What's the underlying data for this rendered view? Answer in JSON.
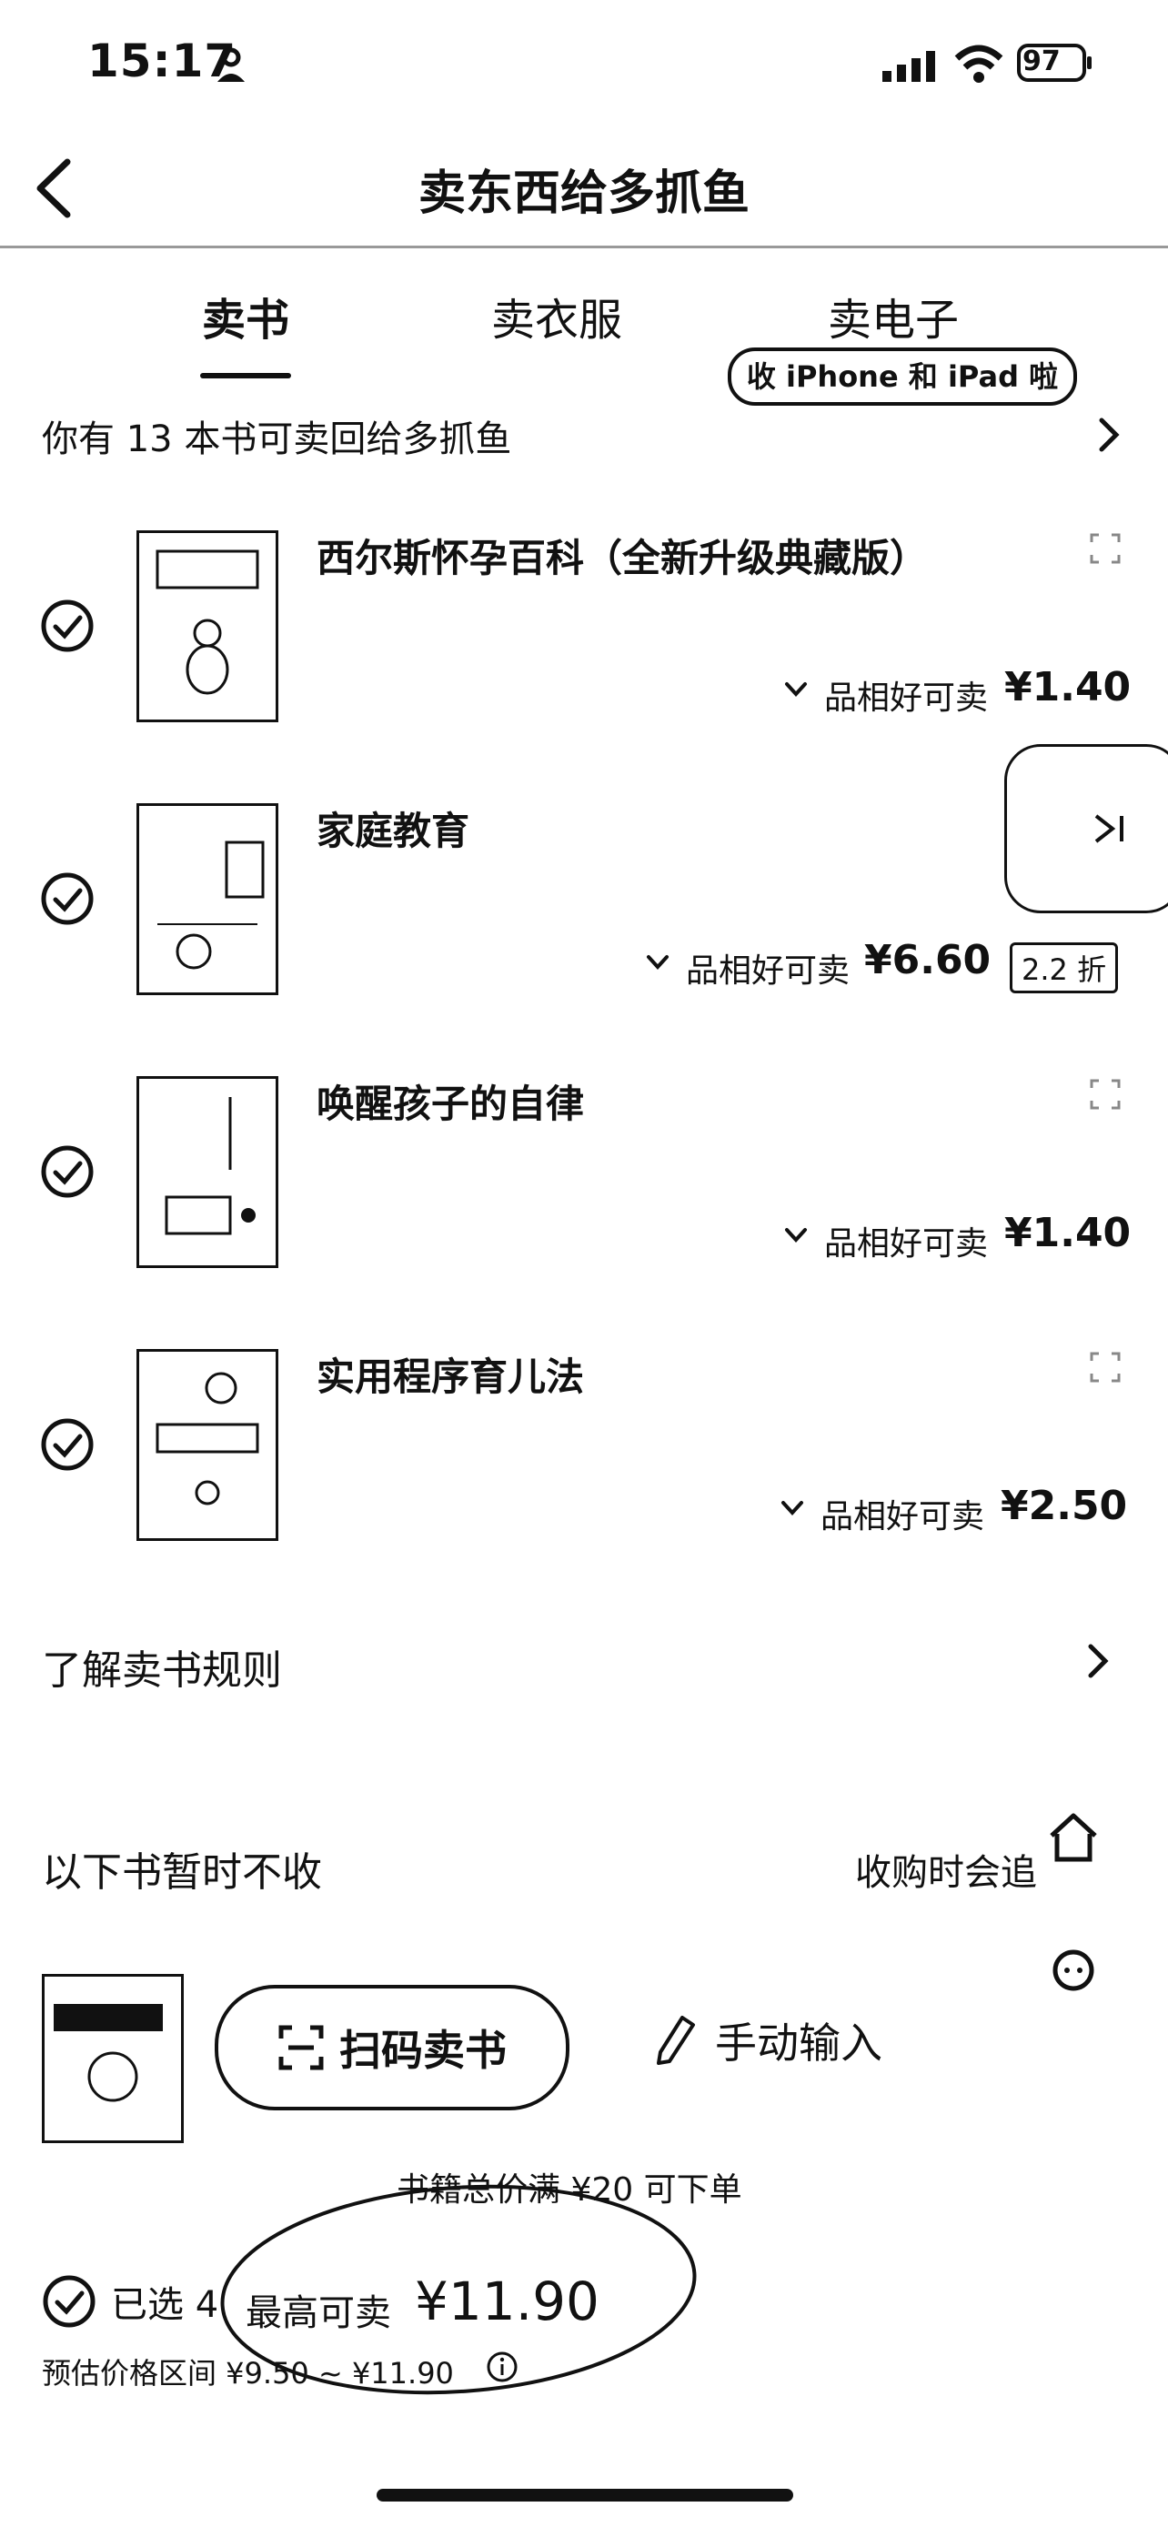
{
  "status_bar": {
    "time": "15:17",
    "battery": "97"
  },
  "header": {
    "title": "卖东西给多抓鱼"
  },
  "tabs": [
    {
      "label": "卖书",
      "active": true
    },
    {
      "label": "卖衣服",
      "active": false
    },
    {
      "label": "卖电子",
      "active": false
    }
  ],
  "promo_badge": "收 iPhone 和 iPad 啦",
  "summary": "你有 13 本书可卖回给多抓鱼",
  "books": [
    {
      "title": "西尔斯怀孕百科（全新升级典藏版）",
      "condition": "品相好可卖",
      "price": "¥1.40",
      "discount": "",
      "selected": true
    },
    {
      "title": "家庭教育",
      "condition": "品相好可卖",
      "price": "¥6.60",
      "discount": "2.2 折",
      "selected": true
    },
    {
      "title": "唤醒孩子的自律",
      "condition": "品相好可卖",
      "price": "¥1.40",
      "discount": "",
      "selected": true
    },
    {
      "title": "实用程序育儿法",
      "condition": "品相好可卖",
      "price": "¥2.50",
      "discount": "",
      "selected": true
    }
  ],
  "rules_link": "了解卖书规则",
  "not_accepted": {
    "title": "以下书暂时不收",
    "note": "收购时会追"
  },
  "actions": {
    "scan": "扫码卖书",
    "manual": "手动输入"
  },
  "footer": {
    "minimum": "书籍总价满 ¥20 可下单",
    "selected_label": "已选 4",
    "max_label": "最高可卖",
    "max_price": "¥11.90",
    "range": "预估价格区间 ¥9.50 ~ ¥11.90"
  },
  "colors": {
    "text": "#111111",
    "divider": "#999999",
    "background": "#ffffff"
  }
}
